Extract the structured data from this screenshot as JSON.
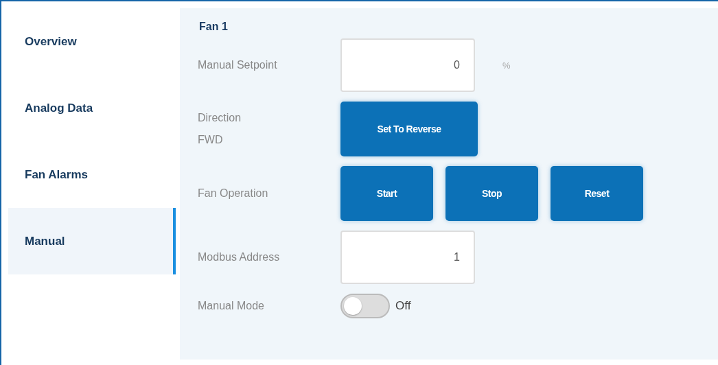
{
  "sidebar": {
    "items": [
      {
        "label": "Overview",
        "selected": false
      },
      {
        "label": "Analog Data",
        "selected": false
      },
      {
        "label": "Fan Alarms",
        "selected": false
      },
      {
        "label": "Manual",
        "selected": true
      }
    ]
  },
  "panel": {
    "title": "Fan 1",
    "rows": [
      {
        "kind": "field",
        "label": "Manual Setpoint",
        "value": "0",
        "unit": "%"
      },
      {
        "kind": "buttons",
        "label": "Direction",
        "status": "FWD",
        "buttons": [
          "Set To Reverse"
        ]
      },
      {
        "kind": "buttons",
        "label": "Fan Operation",
        "buttons": [
          "Start",
          "Stop",
          "Reset"
        ]
      },
      {
        "kind": "field",
        "label": "Modbus Address",
        "value": "1"
      },
      {
        "kind": "toggle",
        "label": "Manual Mode",
        "on": false,
        "state_label": "Off"
      }
    ]
  }
}
